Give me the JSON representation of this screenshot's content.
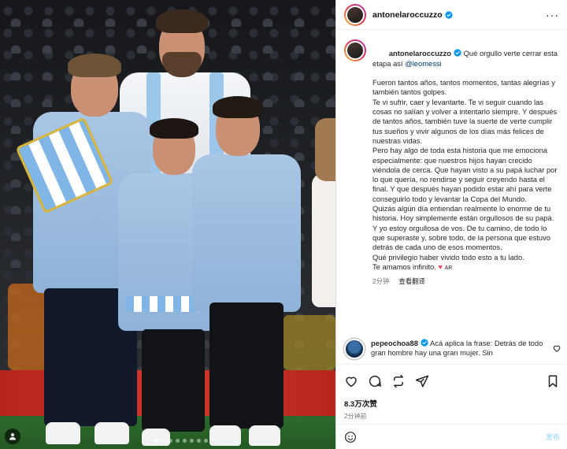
{
  "post": {
    "username": "antonelaroccuzzo",
    "more_label": "···"
  },
  "caption": {
    "username": "antonelaroccuzzo",
    "intro": " Qué orgullo verte cerrar esta etapa así ",
    "mention": "@leomessi",
    "text": "Fueron tantos años, tantos momentos, tantas alegrías y también tantos golpes.\nTe vi sufrir, caer y levantarte. Te vi seguir cuando las cosas no salían y volver a intentarlo siempre. Y después de tantos años, también tuve la suerte de verte cumplir tus sueños y vivir algunos de los días más felices de nuestras vidas.\nPero hay algo de toda esta historia que me emociona especialmente: que nuestros hijos hayan crecido viéndola de cerca. Que hayan visto a su papá luchar por lo que quería, no rendirse y seguir creyendo hasta el final. Y que después hayan podido estar ahí para verte conseguirlo todo y levantar la Copa del Mundo.\nQuizás algún día entiendan realmente lo enorme de tu historia. Hoy simplemente están orgullosos de su papá.\nY yo estoy orgullosa de vos. De tu camino, de todo lo que superaste y, sobre todo, de la persona que estuvo detrás de cada uno de esos momentos.\nQué privilegio haber vivido todo esto a tu lado.\nTe amamos infinito. ",
    "heart": "♥",
    "flag": "AR",
    "time": "2分钟",
    "see_translation": "查看翻译"
  },
  "comment": {
    "username": "pepeochoa88",
    "text": " Acá aplica la frase: Detrás de todo gran hombre hay una gran mujer. Sin"
  },
  "actions": {
    "likes": "8.3万次赞",
    "time": "2分钟前"
  },
  "comment_box": {
    "placeholder": "",
    "post_label": "发布"
  },
  "icons": {
    "verified": "verified-badge-icon",
    "like": "heart-icon",
    "comment": "comment-bubble-icon",
    "share": "repost-icon",
    "send": "paper-plane-icon",
    "save": "bookmark-icon",
    "emoji": "emoji-icon",
    "user_tag": "user-tag-icon"
  },
  "colors": {
    "verified": "#0095f6",
    "link": "#00376b",
    "meta": "#737373",
    "heart": "#ed4956"
  }
}
